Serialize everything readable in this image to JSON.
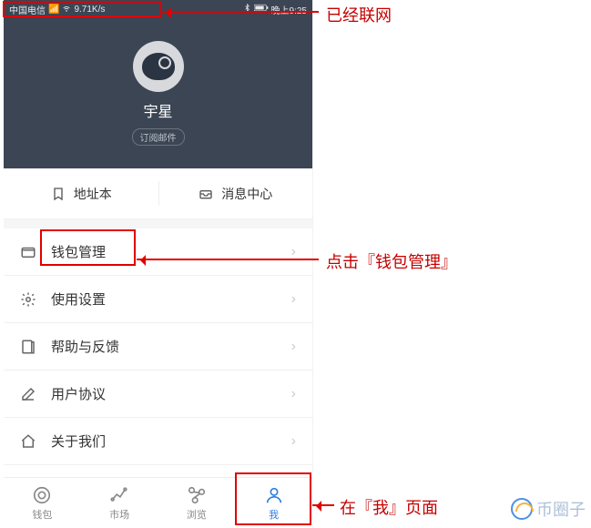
{
  "status": {
    "carrier": "中国电信",
    "speed": "9.71K/s",
    "time": "晚上9:25"
  },
  "profile": {
    "display_name": "宇星",
    "sub_badge": "订阅邮件"
  },
  "quick": {
    "address_book": "地址本",
    "message_center": "消息中心"
  },
  "menu": {
    "wallet_manage": "钱包管理",
    "settings": "使用设置",
    "help_feedback": "帮助与反馈",
    "user_agreement": "用户协议",
    "about_us": "关于我们"
  },
  "tabs": {
    "wallet": "钱包",
    "market": "市场",
    "browse": "浏览",
    "me": "我"
  },
  "annotations": {
    "networked": "已经联网",
    "click_wallet_manage": "点击『钱包管理』",
    "on_me_page": "在『我』页面"
  },
  "watermark": "币圈子"
}
